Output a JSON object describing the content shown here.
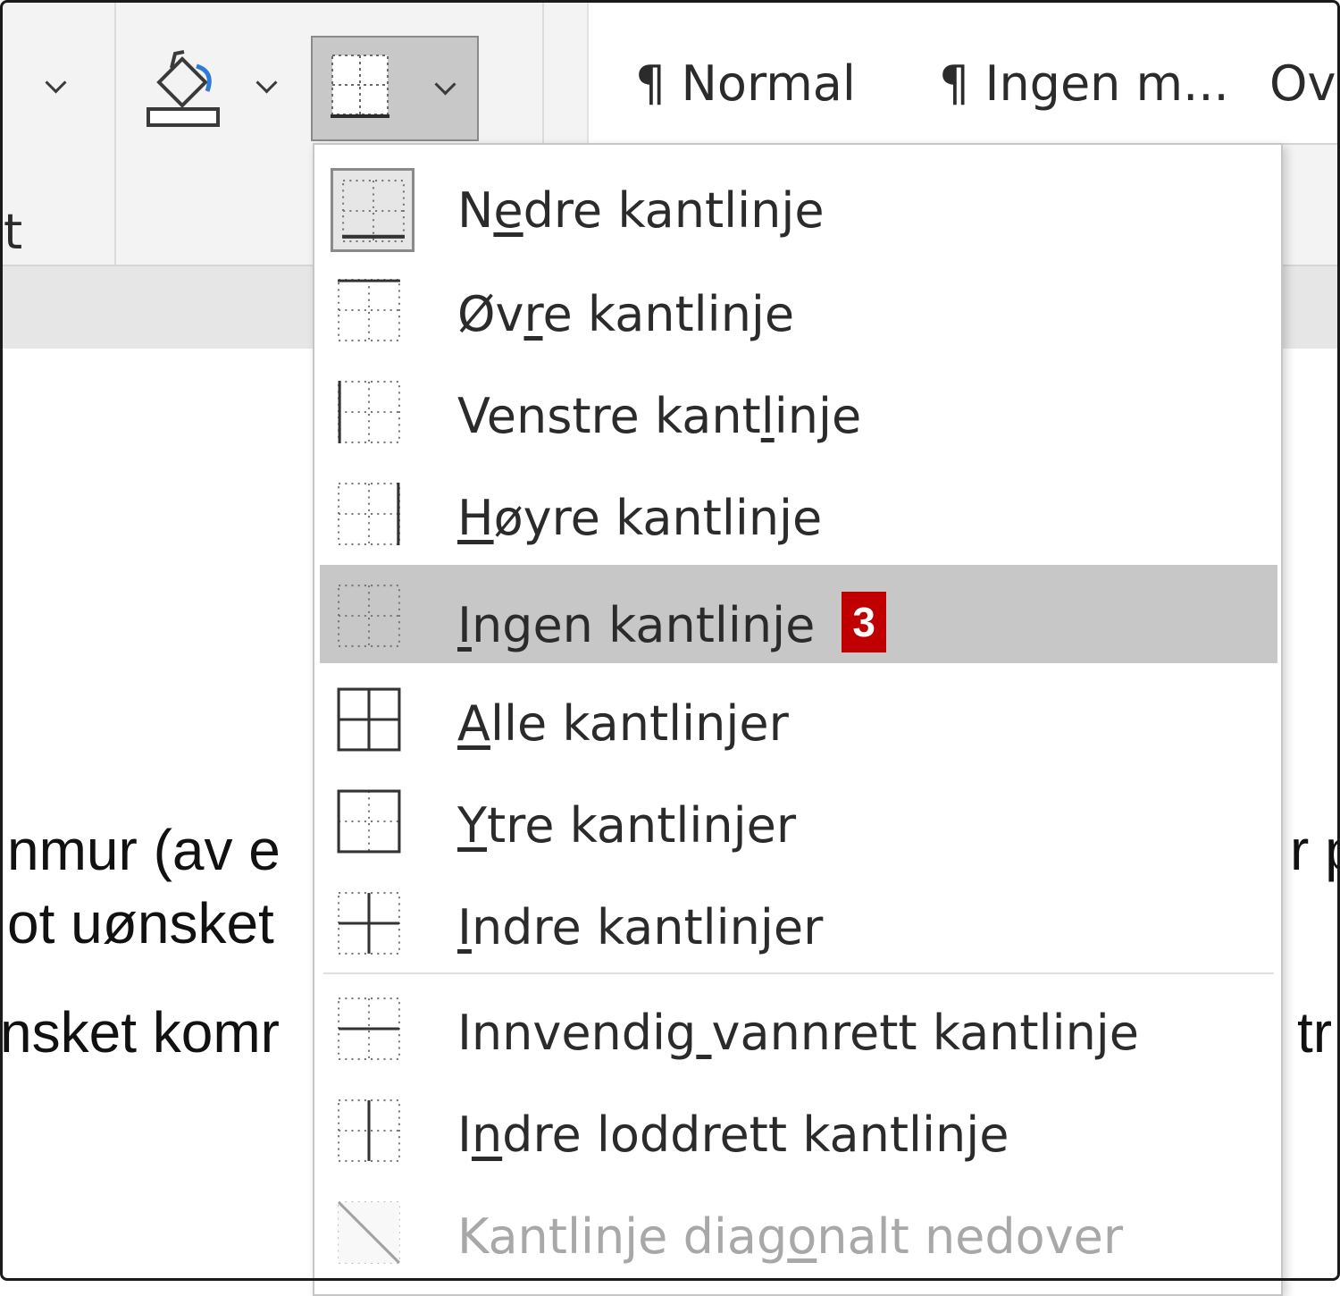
{
  "ribbon": {
    "left_fragment_bottom": "t",
    "styles": [
      "¶ Normal",
      "¶ Ingen m...",
      "Ov"
    ]
  },
  "document": {
    "left_lines": [
      "nmur (av e",
      "ot uønsket",
      "nsket komr"
    ],
    "right_lines": [
      "r p",
      "tr"
    ]
  },
  "menu": {
    "items": [
      {
        "label": "Nedre kantlinje",
        "ul": 1,
        "icon": "bottom-border-icon",
        "boxed": true
      },
      {
        "label": "Øvre kantlinje",
        "ul": 2,
        "icon": "top-border-icon"
      },
      {
        "label": "Venstre kantlinje",
        "ul": 12,
        "icon": "left-border-icon"
      },
      {
        "label": "Høyre kantlinje",
        "ul": 0,
        "icon": "right-border-icon"
      },
      {
        "label": "Ingen kantlinje",
        "ul": 0,
        "icon": "no-border-icon",
        "highlight": true,
        "badge": "3"
      },
      {
        "label": "Alle kantlinjer",
        "ul": 0,
        "icon": "all-borders-icon"
      },
      {
        "label": "Ytre kantlinjer",
        "ul": 0,
        "icon": "outside-borders-icon"
      },
      {
        "label": "Indre kantlinjer",
        "ul": 0,
        "icon": "inside-borders-icon"
      },
      {
        "label": "Innvendig vannrett kantlinje",
        "ul": 9,
        "icon": "inside-horizontal-border-icon"
      },
      {
        "label": "Indre loddrett kantlinje",
        "ul": 1,
        "icon": "inside-vertical-border-icon"
      },
      {
        "label": "Kantlinje diagonalt nedover",
        "ul": 14,
        "icon": "diagonal-down-border-icon",
        "disabled": true
      }
    ]
  }
}
